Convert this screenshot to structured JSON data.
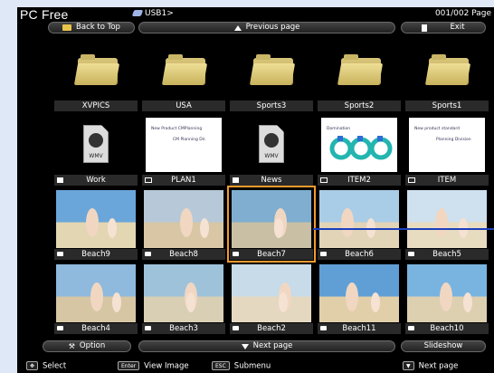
{
  "header": {
    "app_title": "PC Free",
    "path": "USB1>",
    "page_count": "001/002 Page"
  },
  "toolbar": {
    "back_to_top": "Back to Top",
    "previous_page": "Previous page",
    "exit": "Exit"
  },
  "files": [
    {
      "label": "XVPICS",
      "type": "folder"
    },
    {
      "label": "USA",
      "type": "folder"
    },
    {
      "label": "Sports3",
      "type": "folder"
    },
    {
      "label": "Sports2",
      "type": "folder"
    },
    {
      "label": "Sports1",
      "type": "folder"
    },
    {
      "label": "Work",
      "type": "video"
    },
    {
      "label": "PLAN1",
      "type": "presentation",
      "slide_text": "New Product CMPlanning",
      "slide_sub": "CM Planning Dir."
    },
    {
      "label": "News",
      "type": "video"
    },
    {
      "label": "ITEM2",
      "type": "presentation",
      "slide_text": "Domination"
    },
    {
      "label": "ITEM",
      "type": "presentation",
      "slide_text": "New product standard",
      "slide_sub": "Planning Division"
    },
    {
      "label": "Beach9",
      "type": "image"
    },
    {
      "label": "Beach8",
      "type": "image"
    },
    {
      "label": "Beach7",
      "type": "image",
      "selected": true
    },
    {
      "label": "Beach6",
      "type": "image"
    },
    {
      "label": "Beach5",
      "type": "image"
    },
    {
      "label": "Beach4",
      "type": "image"
    },
    {
      "label": "Beach3",
      "type": "image"
    },
    {
      "label": "Beach2",
      "type": "image"
    },
    {
      "label": "Beach11",
      "type": "image"
    },
    {
      "label": "Beach10",
      "type": "image"
    }
  ],
  "bottom_bar": {
    "option": "Option",
    "next_page": "Next page",
    "slideshow": "Slideshow"
  },
  "footer": {
    "select": "Select",
    "enter_key": "Enter",
    "view_image": "View Image",
    "esc_key": "ESC",
    "submenu": "Submenu",
    "next_page": "Next page"
  },
  "wmv_text": "WMV",
  "colors": {
    "selection": "#f29a2e",
    "callout_line": "#1b3fbd",
    "background": "#000000"
  }
}
